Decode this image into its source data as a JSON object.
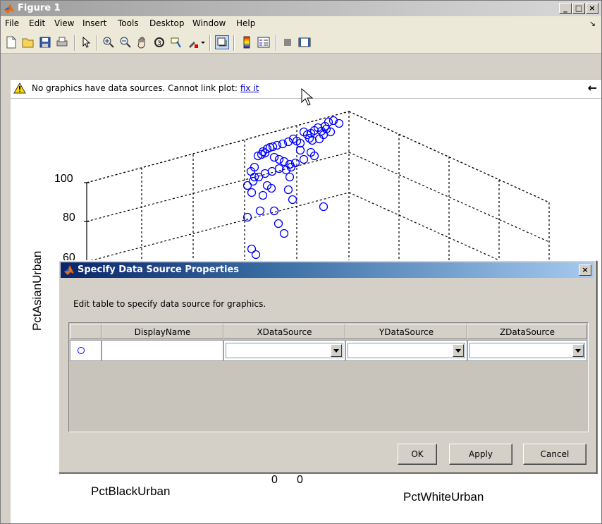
{
  "window": {
    "title": "Figure 1",
    "minimize": "_",
    "maximize": "□",
    "close": "×"
  },
  "menu": [
    "File",
    "Edit",
    "View",
    "Insert",
    "Tools",
    "Desktop",
    "Window",
    "Help"
  ],
  "dock_glyph": "↘",
  "toolbar_icons": [
    "new-figure-icon",
    "open-file-icon",
    "save-icon",
    "print-icon",
    "pointer-icon",
    "zoom-in-icon",
    "zoom-out-icon",
    "pan-icon",
    "rotate-3d-icon",
    "data-cursor-icon",
    "brush-icon",
    "brush-dropdown-icon",
    "link-plot-icon",
    "colorbar-icon",
    "legend-icon",
    "hide-plot-tools-icon",
    "show-plot-tools-icon"
  ],
  "infobar": {
    "message": "No graphics have data sources. Cannot link plot:",
    "link": "fix it",
    "back_glyph": "←"
  },
  "axes": {
    "zlabel": "PctAsianUrban",
    "xlabel": "PctBlackUrban",
    "ylabel": "PctWhiteUrban",
    "ztick_100": "100",
    "ztick_80": "80",
    "ztick_60": "60",
    "xtick_0": "0",
    "ytick_0": "0"
  },
  "chart_data": {
    "type": "scatter",
    "marker": "circle",
    "marker_color": "#0000ff",
    "zlabel": "PctAsianUrban",
    "xlabel": "PctBlackUrban",
    "ylabel": "PctWhiteUrban",
    "zticks": [
      60,
      80,
      100
    ],
    "grid": true,
    "points_screen_note_only": false,
    "points": [
      [
        465,
        172
      ],
      [
        472,
        170
      ],
      [
        480,
        174
      ],
      [
        460,
        178
      ],
      [
        455,
        185
      ],
      [
        462,
        182
      ],
      [
        468,
        186
      ],
      [
        450,
        180
      ],
      [
        445,
        184
      ],
      [
        440,
        188
      ],
      [
        435,
        190
      ],
      [
        430,
        186
      ],
      [
        438,
        195
      ],
      [
        442,
        198
      ],
      [
        415,
        196
      ],
      [
        420,
        199
      ],
      [
        425,
        202
      ],
      [
        408,
        200
      ],
      [
        400,
        203
      ],
      [
        392,
        205
      ],
      [
        386,
        207
      ],
      [
        378,
        210
      ],
      [
        372,
        214
      ],
      [
        382,
        208
      ],
      [
        375,
        216
      ],
      [
        370,
        218
      ],
      [
        365,
        220
      ],
      [
        388,
        222
      ],
      [
        395,
        225
      ],
      [
        402,
        228
      ],
      [
        410,
        232
      ],
      [
        418,
        230
      ],
      [
        412,
        236
      ],
      [
        405,
        240
      ],
      [
        395,
        238
      ],
      [
        385,
        242
      ],
      [
        375,
        245
      ],
      [
        366,
        250
      ],
      [
        358,
        256
      ],
      [
        350,
        262
      ],
      [
        360,
        236
      ],
      [
        355,
        242
      ],
      [
        360,
        250
      ],
      [
        384,
        266
      ],
      [
        372,
        276
      ],
      [
        410,
        250
      ],
      [
        440,
        215
      ],
      [
        430,
        225
      ],
      [
        425,
        212
      ],
      [
        445,
        220
      ],
      [
        388,
        298
      ],
      [
        368,
        298
      ],
      [
        350,
        307
      ],
      [
        394,
        316
      ],
      [
        402,
        330
      ],
      [
        356,
        352
      ],
      [
        362,
        360
      ],
      [
        458,
        292
      ],
      [
        414,
        282
      ],
      [
        408,
        268
      ],
      [
        378,
        262
      ],
      [
        356,
        272
      ],
      [
        452,
        196
      ],
      [
        458,
        190
      ]
    ]
  },
  "dialog": {
    "title": "Specify Data Source Properties",
    "close": "×",
    "description": "Edit table to specify data source for graphics.",
    "columns": [
      "DisplayName",
      "XDataSource",
      "YDataSource",
      "ZDataSource"
    ],
    "row": {
      "display_name": "",
      "x": "",
      "y": "",
      "z": ""
    },
    "buttons": {
      "ok": "OK",
      "apply": "Apply",
      "cancel": "Cancel"
    }
  }
}
